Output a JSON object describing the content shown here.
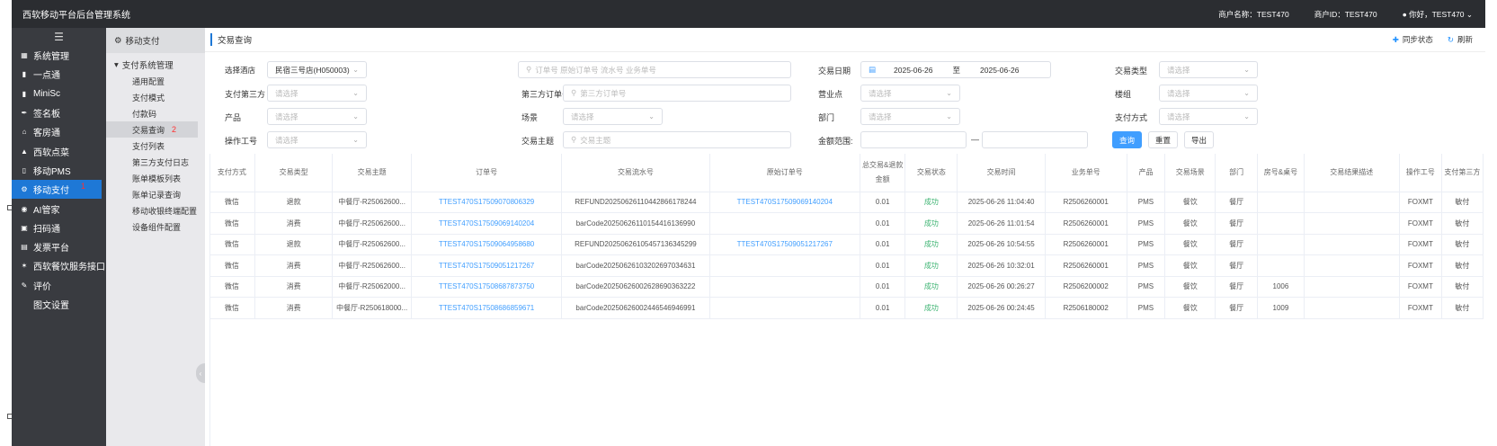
{
  "topbar": {
    "title": "西软移动平台后台管理系统",
    "merchant_name": "商户名称：TEST470",
    "merchant_id": "商户ID：TEST470",
    "user": "你好，TEST470"
  },
  "sidebar": {
    "items": [
      {
        "label": "系统管理",
        "icon": "grid-icon"
      },
      {
        "label": "一点通",
        "icon": "bar-chart-icon"
      },
      {
        "label": "MiniSc",
        "icon": "bar-chart-icon"
      },
      {
        "label": "签名板",
        "icon": "pen-icon"
      },
      {
        "label": "客房通",
        "icon": "home-icon"
      },
      {
        "label": "西软点菜",
        "icon": "bowl-icon"
      },
      {
        "label": "移动PMS",
        "icon": "mobile-icon"
      },
      {
        "label": "移动支付",
        "icon": "gear-icon",
        "badge": "1"
      },
      {
        "label": "AI管家",
        "icon": "robot-icon"
      },
      {
        "label": "扫码通",
        "icon": "scan-icon"
      },
      {
        "label": "发票平台",
        "icon": "invoice-icon"
      },
      {
        "label": "西软餐饮服务接口",
        "icon": "star-icon"
      },
      {
        "label": "评价",
        "icon": "edit-icon"
      },
      {
        "label": "图文设置",
        "icon": ""
      }
    ]
  },
  "submenu": {
    "head": "移动支付",
    "group": "支付系统管理",
    "links": [
      {
        "label": "通用配置"
      },
      {
        "label": "支付模式"
      },
      {
        "label": "付款码"
      },
      {
        "label": "交易查询",
        "badge": "2"
      },
      {
        "label": "支付列表"
      },
      {
        "label": "第三方支付日志"
      },
      {
        "label": "账单模板列表"
      },
      {
        "label": "账单记录查询"
      },
      {
        "label": "移动收银终端配置"
      },
      {
        "label": "设备组件配置"
      }
    ]
  },
  "main": {
    "title": "交易查询",
    "sync": "同步状态",
    "refresh": "刷新"
  },
  "filters": {
    "hotel_label": "选择酒店",
    "hotel_value": "民宿三号店(H050003)",
    "order_search_placeholder": "订单号 原始订单号 流水号 业务单号",
    "date_label": "交易日期",
    "date_from": "2025-06-26",
    "date_to_sep": "至",
    "date_to": "2025-06-26",
    "trade_type_label": "交易类型",
    "placeholder": "请选择",
    "third_label": "支付第三方",
    "third_order_label": "第三方订单号",
    "third_order_placeholder": "第三方订单号",
    "outlet_label": "营业点",
    "building_label": "楼组",
    "product_label": "产品",
    "scene_label": "场景",
    "dept_label": "部门",
    "paymethod_label": "支付方式",
    "operator_label": "操作工号",
    "subject_label": "交易主题",
    "subject_placeholder": "交易主题",
    "amount_label": "金额范围:",
    "amount_sep": "—",
    "btn_query": "查询",
    "btn_reset": "重置",
    "btn_export": "导出"
  },
  "table": {
    "headers": [
      "支付方式",
      "交易类型",
      "交易主题",
      "订单号",
      "交易流水号",
      "原始订单号",
      "总交易&退款金额",
      "交易状态",
      "交易时间",
      "业务单号",
      "产品",
      "交易场景",
      "部门",
      "房号&桌号",
      "交易结果描述",
      "操作工号",
      "支付第三方"
    ],
    "rows": [
      [
        "微信",
        "退款",
        "中餐厅-R25062600...",
        "TTEST470S17509070806329",
        "REFUND20250626110442866178244",
        "TTEST470S17509069140204",
        "0.01",
        "成功",
        "2025-06-26 11:04:40",
        "R2506260001",
        "PMS",
        "餐饮",
        "餐厅",
        "",
        "",
        "FOXMT",
        "敏付"
      ],
      [
        "微信",
        "消费",
        "中餐厅-R25062600...",
        "TTEST470S17509069140204",
        "barCode20250626110154416136990",
        "",
        "0.01",
        "成功",
        "2025-06-26 11:01:54",
        "R2506260001",
        "PMS",
        "餐饮",
        "餐厅",
        "",
        "",
        "FOXMT",
        "敏付"
      ],
      [
        "微信",
        "退款",
        "中餐厅-R25062600...",
        "TTEST470S17509064958680",
        "REFUND20250626105457136345299",
        "TTEST470S17509051217267",
        "0.01",
        "成功",
        "2025-06-26 10:54:55",
        "R2506260001",
        "PMS",
        "餐饮",
        "餐厅",
        "",
        "",
        "FOXMT",
        "敏付"
      ],
      [
        "微信",
        "消费",
        "中餐厅-R25062600...",
        "TTEST470S17509051217267",
        "barCode20250626103202697034631",
        "",
        "0.01",
        "成功",
        "2025-06-26 10:32:01",
        "R2506260001",
        "PMS",
        "餐饮",
        "餐厅",
        "",
        "",
        "FOXMT",
        "敏付"
      ],
      [
        "微信",
        "消费",
        "中餐厅-R25062000...",
        "TTEST470S17508687873750",
        "barCode20250626002628690363222",
        "",
        "0.01",
        "成功",
        "2025-06-26 00:26:27",
        "R2506200002",
        "PMS",
        "餐饮",
        "餐厅",
        "1006",
        "",
        "FOXMT",
        "敏付"
      ],
      [
        "微信",
        "消费",
        "中餐厅-R250618000...",
        "TTEST470S17508686859671",
        "barCode20250626002446546946991",
        "",
        "0.01",
        "成功",
        "2025-06-26 00:24:45",
        "R2506180002",
        "PMS",
        "餐饮",
        "餐厅",
        "1009",
        "",
        "FOXMT",
        "敏付"
      ]
    ]
  }
}
